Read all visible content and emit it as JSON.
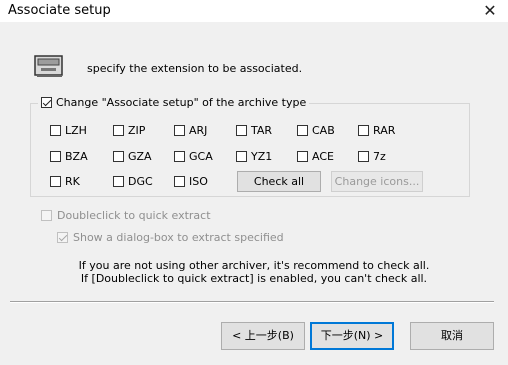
{
  "window": {
    "title": "Associate setup",
    "close_glyph": "✕"
  },
  "instruction": "specify the extension to be associated.",
  "group": {
    "label": "Change \"Associate setup\" of the archive type",
    "checked": true
  },
  "extensions": [
    {
      "label": "LZH",
      "checked": false
    },
    {
      "label": "ZIP",
      "checked": false
    },
    {
      "label": "ARJ",
      "checked": false
    },
    {
      "label": "TAR",
      "checked": false
    },
    {
      "label": "CAB",
      "checked": false
    },
    {
      "label": "RAR",
      "checked": false
    },
    {
      "label": "BZA",
      "checked": false
    },
    {
      "label": "GZA",
      "checked": false
    },
    {
      "label": "GCA",
      "checked": false
    },
    {
      "label": "YZ1",
      "checked": false
    },
    {
      "label": "ACE",
      "checked": false
    },
    {
      "label": "7z",
      "checked": false
    },
    {
      "label": "RK",
      "checked": false
    },
    {
      "label": "DGC",
      "checked": false
    },
    {
      "label": "ISO",
      "checked": false
    }
  ],
  "buttons": {
    "check_all": "Check all",
    "change_icons": "Change icons...",
    "back": "< 上一步(B)",
    "next": "下一步(N) >",
    "cancel": "取消"
  },
  "options": {
    "doubleclick": {
      "label": "Doubleclick to quick extract",
      "checked": false,
      "enabled": false
    },
    "show_dialog": {
      "label": "Show a dialog-box to extract specified",
      "checked": true,
      "enabled": false
    }
  },
  "info": {
    "line1": "If you are not using other archiver, it's recommend to check all.",
    "line2": "If [Doubleclick to quick extract] is enabled, you can't check all."
  },
  "icons": {
    "drive": "drive-icon",
    "close": "close-icon",
    "checkbox": "checkbox-icon"
  }
}
